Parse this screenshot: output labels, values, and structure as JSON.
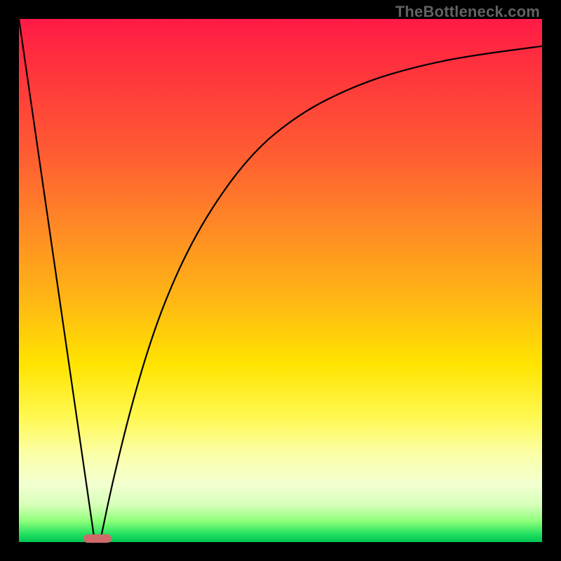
{
  "watermark": "TheBottleneck.com",
  "chart_data": {
    "type": "line",
    "title": "",
    "xlabel": "",
    "ylabel": "",
    "xlim": [
      0,
      100
    ],
    "ylim": [
      0,
      100
    ],
    "grid": false,
    "legend": false,
    "series": [
      {
        "name": "v-left",
        "x": [
          0,
          14.5
        ],
        "values": [
          100,
          0
        ]
      },
      {
        "name": "v-right-curve",
        "x": [
          15.5,
          18,
          22,
          26,
          30,
          34,
          38,
          42,
          46,
          50,
          55,
          60,
          66,
          72,
          80,
          88,
          100
        ],
        "values": [
          0,
          12,
          28,
          41,
          51,
          59,
          65.5,
          71,
          75.5,
          79,
          82.5,
          85.2,
          87.8,
          89.8,
          91.8,
          93.2,
          94.8
        ]
      }
    ],
    "marker": {
      "x_center": 15,
      "y": 0,
      "width_pct": 5.4
    },
    "background_gradient": {
      "stops": [
        {
          "pct": 0,
          "color": "#ff1a48"
        },
        {
          "pct": 25,
          "color": "#ff5a33"
        },
        {
          "pct": 54,
          "color": "#ffb814"
        },
        {
          "pct": 76,
          "color": "#fff850"
        },
        {
          "pct": 93,
          "color": "#d6ffb8"
        },
        {
          "pct": 100,
          "color": "#00c455"
        }
      ]
    }
  }
}
